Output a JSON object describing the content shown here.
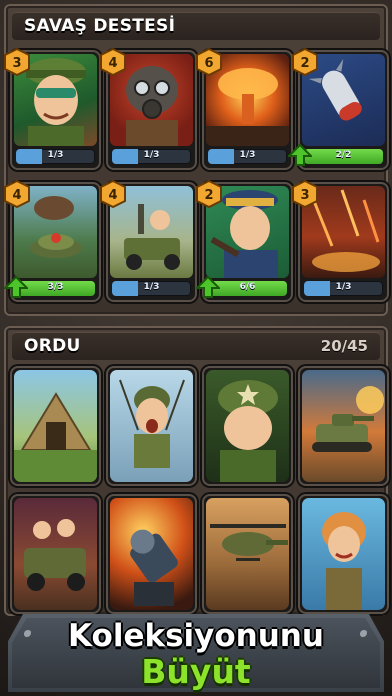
{
  "deck": {
    "title": "SAVAŞ DESTESİ",
    "cards": [
      {
        "name": "card-soldier-kid",
        "cost": "3",
        "level": "1/3",
        "progress": 0.33,
        "upgradable": false
      },
      {
        "name": "card-gas-mask",
        "cost": "4",
        "level": "1/3",
        "progress": 0.33,
        "upgradable": false
      },
      {
        "name": "card-nuke",
        "cost": "6",
        "level": "1/3",
        "progress": 0.33,
        "upgradable": false
      },
      {
        "name": "card-missile",
        "cost": "2",
        "level": "2/2",
        "progress": 1.0,
        "upgradable": true
      },
      {
        "name": "card-landmine",
        "cost": "4",
        "level": "3/3",
        "progress": 1.0,
        "upgradable": true
      },
      {
        "name": "card-jeep-gunner",
        "cost": "4",
        "level": "1/3",
        "progress": 0.33,
        "upgradable": false
      },
      {
        "name": "card-officer",
        "cost": "2",
        "level": "6/6",
        "progress": 1.0,
        "upgradable": true
      },
      {
        "name": "card-rain-of-fire",
        "cost": "3",
        "level": "1/3",
        "progress": 0.33,
        "upgradable": false
      }
    ]
  },
  "army": {
    "title": "ORDU",
    "count": "20/45",
    "cards": [
      {
        "name": "card-tent"
      },
      {
        "name": "card-paratrooper"
      },
      {
        "name": "card-sergeant"
      },
      {
        "name": "card-tank"
      },
      {
        "name": "card-jeep-squad"
      },
      {
        "name": "card-gatling"
      },
      {
        "name": "card-helicopter"
      },
      {
        "name": "card-heroine"
      }
    ]
  },
  "banner": {
    "line1": "Koleksiyonunu",
    "line2": "Büyüt"
  }
}
